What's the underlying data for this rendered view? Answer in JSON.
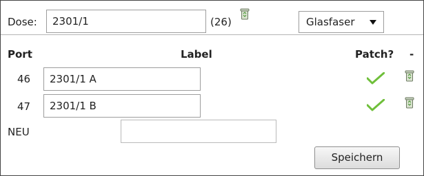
{
  "dose": {
    "label": "Dose:",
    "value": "2301/1",
    "count": "(26)",
    "delete_icon": "trash-bin-icon",
    "type_select": {
      "selected": "Glasfaser"
    }
  },
  "table": {
    "headers": {
      "port": "Port",
      "label": "Label",
      "patch": "Patch?",
      "remove": "-"
    },
    "rows": [
      {
        "port": "46",
        "label": "2301/1 A",
        "patched": true,
        "patch_icon": "checkmark-icon",
        "delete_icon": "trash-bin-icon"
      },
      {
        "port": "47",
        "label": "2301/1 B",
        "patched": true,
        "patch_icon": "checkmark-icon",
        "delete_icon": "trash-bin-icon"
      }
    ],
    "new_row": {
      "label": "NEU",
      "value": ""
    }
  },
  "actions": {
    "save_label": "Speichern"
  },
  "colors": {
    "check": "#6fbf3a",
    "border": "#9c9c9c",
    "bin": "#7a8a6a"
  }
}
